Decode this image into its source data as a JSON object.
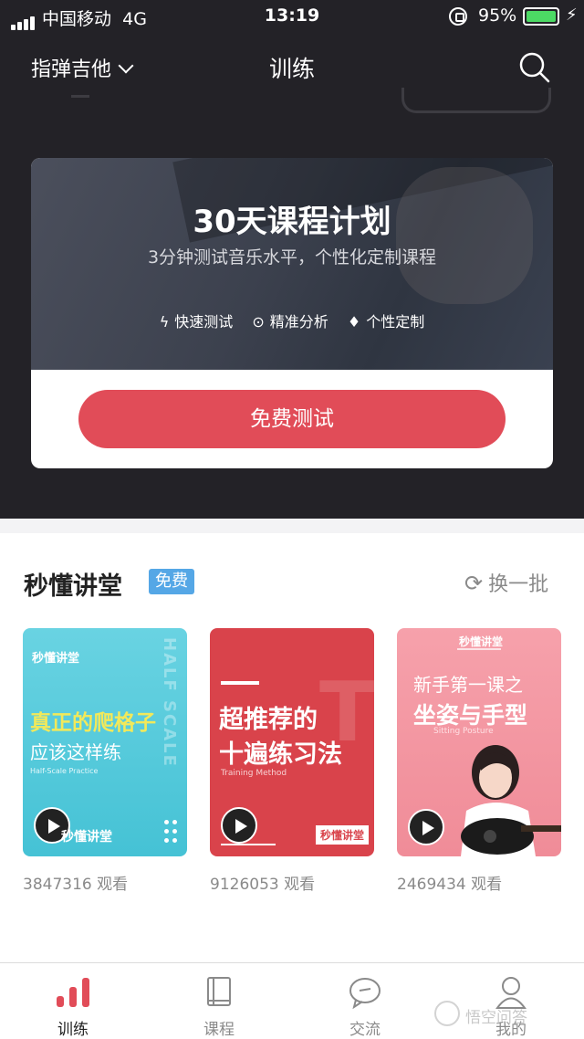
{
  "status_bar": {
    "carrier": "中国移动",
    "network": "4G",
    "time": "13:19",
    "battery": "95%",
    "battery_color": "#4cd964"
  },
  "nav": {
    "instrument": "指弹吉他",
    "title": "训练"
  },
  "banner": {
    "title": "30天课程计划",
    "subtitle": "3分钟测试音乐水平，个性化定制课程",
    "features": [
      {
        "icon": "lightning-icon",
        "label": "快速测试"
      },
      {
        "icon": "target-icon",
        "label": "精准分析"
      },
      {
        "icon": "diamond-icon",
        "label": "个性定制"
      }
    ],
    "cta": "免费测试",
    "cta_color": "#e14c58"
  },
  "section": {
    "title": "秒懂讲堂",
    "badge": "免费",
    "badge_color": "#55a7e6",
    "refresh": "换一批"
  },
  "videos": [
    {
      "brand": "秒懂讲堂",
      "line1": "真正的爬格子",
      "line2": "应该这样练",
      "small": "Half-Scale Practice",
      "vertical": "HALF SCALE",
      "footer": "秒懂讲堂",
      "views": "3847316 观看"
    },
    {
      "line1": "超推荐的",
      "line2": "十遍练习法",
      "small": "Training Method",
      "ghost": "T",
      "tag": "秒懂讲堂",
      "views": "9126053 观看"
    },
    {
      "brand": "秒懂讲堂",
      "line1": "新手第一课之",
      "line2": "坐姿与手型",
      "small": "Sitting Posture",
      "views": "2469434 观看"
    }
  ],
  "tabs": [
    {
      "label": "训练",
      "icon": "bar-chart-icon",
      "active": true
    },
    {
      "label": "课程",
      "icon": "book-icon",
      "active": false
    },
    {
      "label": "交流",
      "icon": "chat-icon",
      "active": false
    },
    {
      "label": "我的",
      "icon": "person-icon",
      "active": false
    }
  ],
  "watermark": "悟空问答",
  "accent": "#e14c58"
}
